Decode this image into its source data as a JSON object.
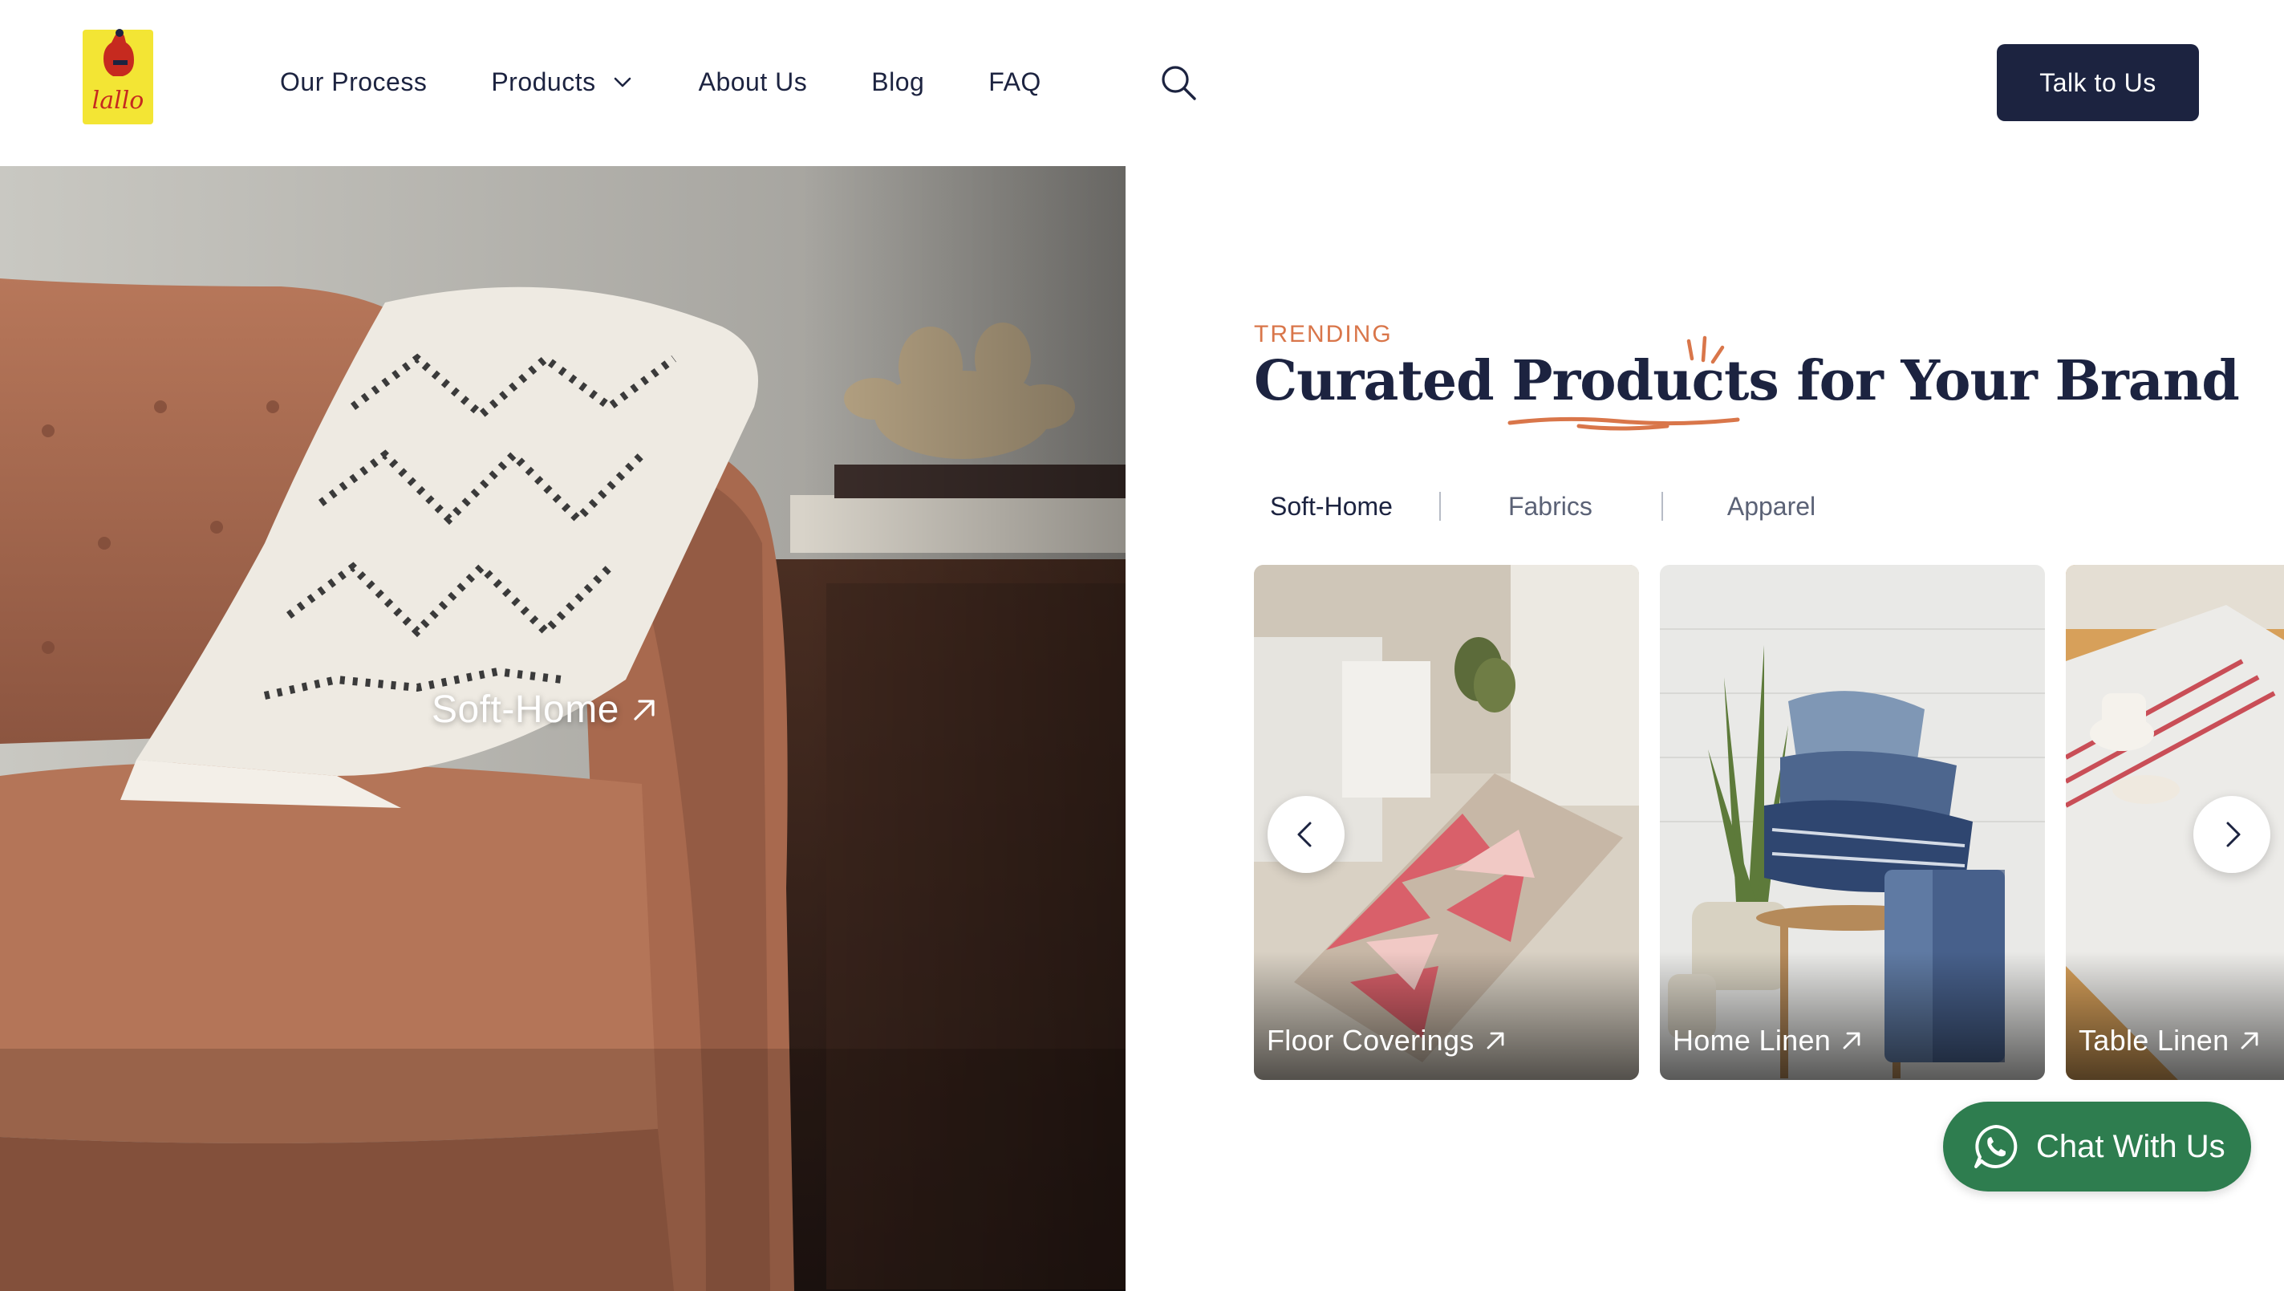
{
  "header": {
    "logo_text": "lallo",
    "nav": [
      {
        "label": "Our Process"
      },
      {
        "label": "Products",
        "has_dropdown": true
      },
      {
        "label": "About Us"
      },
      {
        "label": "Blog"
      },
      {
        "label": "FAQ"
      }
    ],
    "search_icon": "search-icon",
    "cta_label": "Talk to Us"
  },
  "hero": {
    "label": "Soft-Home",
    "arrow_icon": "arrow-up-right-icon"
  },
  "section": {
    "eyebrow": "TRENDING",
    "heading_before": "Curated ",
    "heading_highlight": "Products",
    "heading_after": " for Your Brand"
  },
  "tabs": [
    {
      "label": "Soft-Home",
      "active": true
    },
    {
      "label": "Fabrics",
      "active": false
    },
    {
      "label": "Apparel",
      "active": false
    }
  ],
  "cards": [
    {
      "label": "Floor Coverings"
    },
    {
      "label": "Home Linen"
    },
    {
      "label": "Table Linen"
    }
  ],
  "carousel": {
    "prev_icon": "chevron-left-icon",
    "next_icon": "chevron-right-icon"
  },
  "chat": {
    "label": "Chat With Us",
    "icon": "whatsapp-icon"
  },
  "colors": {
    "navy": "#1c2340",
    "accent": "#d9764a",
    "whatsapp_green": "#2e7d4f"
  }
}
